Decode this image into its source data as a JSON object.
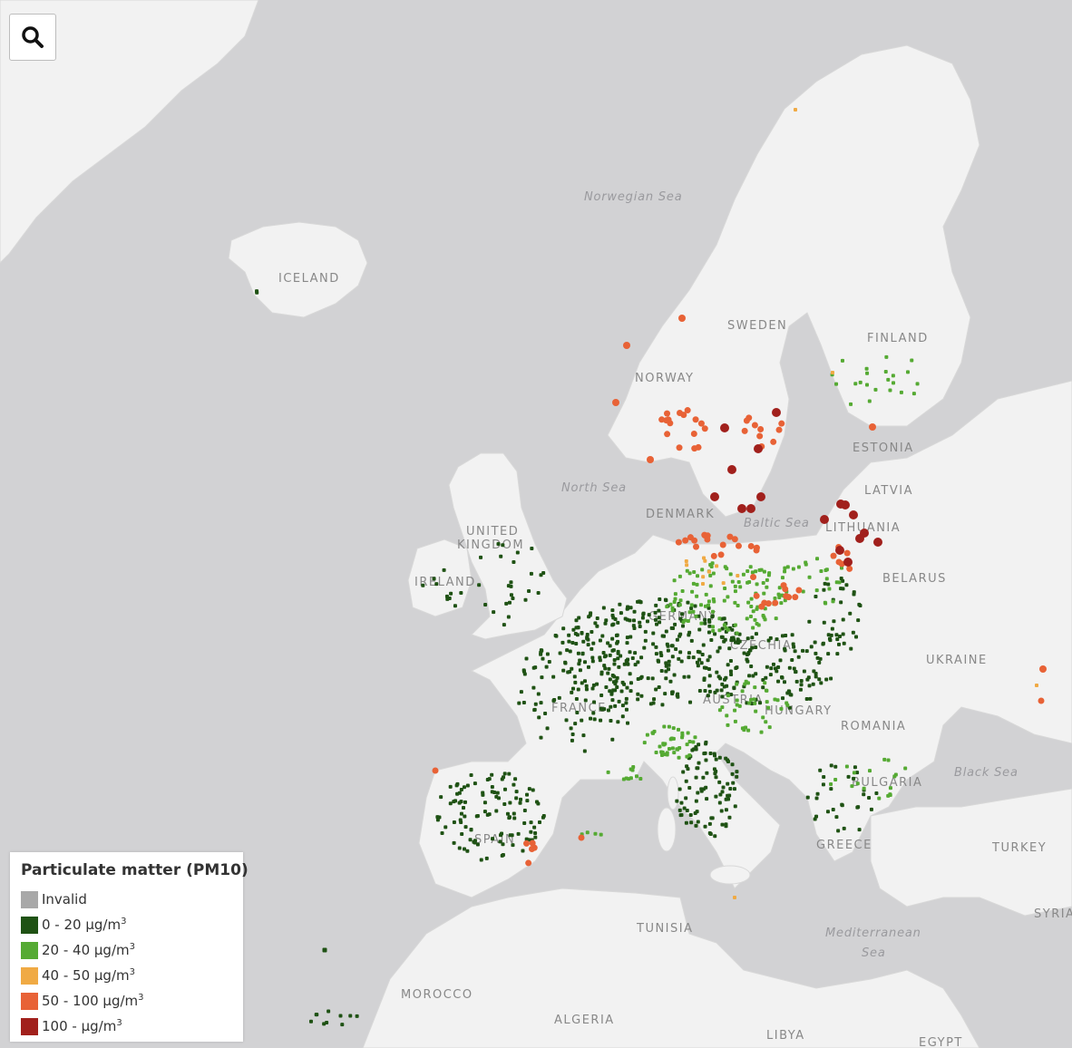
{
  "search": {
    "icon": "search-icon"
  },
  "colors": {
    "sea": "#d2d2d4",
    "land": "#f2f2f2",
    "border": "#c8c8c8",
    "invalid": "#a8a8a8",
    "c0_20": "#1f5214",
    "c20_40": "#55aa33",
    "c40_50": "#f0aa44",
    "c50_100": "#e86236",
    "c100": "#a1201c"
  },
  "labels": {
    "iceland": "ICELAND",
    "norway": "NORWAY",
    "sweden": "SWEDEN",
    "finland": "FINLAND",
    "estonia": "ESTONIA",
    "latvia": "LATVIA",
    "lithuania": "LITHUANIA",
    "denmark": "DENMARK",
    "uk_line1": "UNITED",
    "uk_line2": "KINGDOM",
    "ireland": "IRELAND",
    "belarus": "BELARUS",
    "germany": "GERMANY",
    "czechia": "CZECHIA",
    "austria": "AUSTRIA",
    "hungary": "HUNGARY",
    "france": "FRANCE",
    "ukraine": "UKRAINE",
    "romania": "ROMANIA",
    "bulgaria": "BULGARIA",
    "spain": "SPAIN",
    "greece": "GREECE",
    "turkey": "TURKEY",
    "syria": "SYRIA",
    "tunisia": "TUNISIA",
    "morocco": "MOROCCO",
    "algeria": "ALGERIA",
    "libya": "LIBYA",
    "egypt": "EGYPT"
  },
  "seas": {
    "norwegian": "Norwegian Sea",
    "north": "North Sea",
    "baltic": "Baltic Sea",
    "black": "Black Sea",
    "med_line1": "Mediterranean",
    "med_line2": "Sea"
  },
  "legend": {
    "title": "Particulate matter (PM10)",
    "items": [
      {
        "label": "Invalid",
        "unit": "",
        "color": "#a8a8a8"
      },
      {
        "label": "0 - 20 µg/m",
        "unit": "3",
        "color": "#1f5214"
      },
      {
        "label": "20 - 40 µg/m",
        "unit": "3",
        "color": "#55aa33"
      },
      {
        "label": "40 - 50 µg/m",
        "unit": "3",
        "color": "#f0aa44"
      },
      {
        "label": "50 - 100 µg/m",
        "unit": "3",
        "color": "#e86236"
      },
      {
        "label": "100 - µg/m",
        "unit": "3",
        "color": "#a1201c"
      }
    ]
  }
}
